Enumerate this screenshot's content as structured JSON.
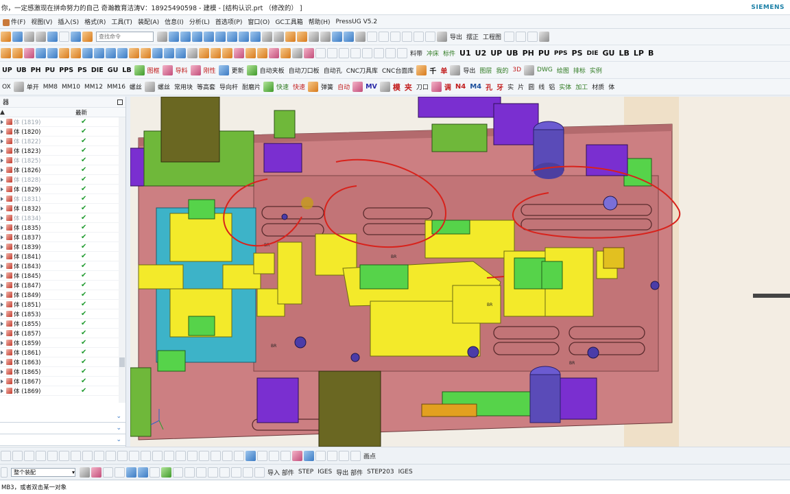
{
  "window": {
    "title": "你，一定感激现在拼命努力的自己  奇瀚教育洁涛V：18925490598 - 建模 - [结构认识.prt （修改的） ]",
    "brand": "SIEMENS"
  },
  "menubar": {
    "items": [
      {
        "label": "件(F)"
      },
      {
        "label": "视图(V)"
      },
      {
        "label": "插入(S)"
      },
      {
        "label": "格式(R)"
      },
      {
        "label": "工具(T)"
      },
      {
        "label": "装配(A)"
      },
      {
        "label": "信息(I)"
      },
      {
        "label": "分析(L)"
      },
      {
        "label": "首选项(P)"
      },
      {
        "label": "窗口(O)"
      },
      {
        "label": "GC工具箱"
      },
      {
        "label": "帮助(H)"
      },
      {
        "label": "PressUG V5.2"
      }
    ],
    "search_placeholder": "查找命令",
    "right_items": [
      "导出",
      "摆正",
      "工程图"
    ]
  },
  "toolbar2": {
    "labels": [
      "料带",
      "冲床",
      "标件",
      "U1",
      "U2",
      "UP",
      "UB",
      "PH",
      "PU",
      "PPS",
      "PS",
      "DIE",
      "GU",
      "LB",
      "LP",
      "B"
    ]
  },
  "toolbar3": {
    "left": [
      "UP",
      "UB",
      "PH",
      "PU",
      "PPS",
      "PS",
      "DIE",
      "GU",
      "LB"
    ],
    "mid": [
      "图框",
      "导料",
      "刚性",
      "更新",
      "自动夹板",
      "自动刀口板",
      "自动孔",
      "CNC刀具库",
      "CNC台面库"
    ],
    "right": [
      "千",
      "单",
      "导出",
      "图层",
      "我的",
      "3D",
      "DWG",
      "绘图",
      "排标",
      "实例"
    ]
  },
  "toolbar4": {
    "left": [
      "OX",
      "单开",
      "MM8",
      "MM10",
      "MM12",
      "MM16",
      "螺丝",
      "螺丝",
      "常用块",
      "等高套",
      "导向杆",
      "耐磨片"
    ],
    "mid": [
      "快速",
      "快速",
      "弹簧",
      "自动",
      "MV",
      "模",
      "夹",
      "刀口"
    ],
    "right": [
      "调",
      "N4",
      "M4",
      "孔",
      "牙",
      "实",
      "片",
      "圆",
      "线",
      "铝",
      "实体",
      "加工",
      "材质",
      "体"
    ]
  },
  "sidebar": {
    "header": "器",
    "col_name": "",
    "col_state": "最新",
    "rows": [
      {
        "label": "体 (1819)",
        "dim": true
      },
      {
        "label": "体 (1820)",
        "dim": false
      },
      {
        "label": "体 (1822)",
        "dim": true
      },
      {
        "label": "体 (1823)",
        "dim": false
      },
      {
        "label": "体 (1825)",
        "dim": true
      },
      {
        "label": "体 (1826)",
        "dim": false
      },
      {
        "label": "体 (1828)",
        "dim": true
      },
      {
        "label": "体 (1829)",
        "dim": false
      },
      {
        "label": "体 (1831)",
        "dim": true
      },
      {
        "label": "体 (1832)",
        "dim": false
      },
      {
        "label": "体 (1834)",
        "dim": true
      },
      {
        "label": "体 (1835)",
        "dim": false
      },
      {
        "label": "体 (1837)",
        "dim": false
      },
      {
        "label": "体 (1839)",
        "dim": false
      },
      {
        "label": "体 (1841)",
        "dim": false
      },
      {
        "label": "体 (1843)",
        "dim": false
      },
      {
        "label": "体 (1845)",
        "dim": false
      },
      {
        "label": "体 (1847)",
        "dim": false
      },
      {
        "label": "体 (1849)",
        "dim": false
      },
      {
        "label": "体 (1851)",
        "dim": false
      },
      {
        "label": "体 (1853)",
        "dim": false
      },
      {
        "label": "体 (1855)",
        "dim": false
      },
      {
        "label": "体 (1857)",
        "dim": false
      },
      {
        "label": "体 (1859)",
        "dim": false
      },
      {
        "label": "体 (1861)",
        "dim": false
      },
      {
        "label": "体 (1863)",
        "dim": false
      },
      {
        "label": "体 (1865)",
        "dim": false
      },
      {
        "label": "体 (1867)",
        "dim": false
      },
      {
        "label": "体 (1869)",
        "dim": false
      }
    ],
    "check_glyph": "✔"
  },
  "viewport": {
    "labels": [
      "BR",
      "BR",
      "BR",
      "BR",
      "BR"
    ]
  },
  "bottombar": {
    "select_value": "整个装配",
    "right_items": [
      "导入 部件",
      "STEP",
      "IGES",
      "导出 部件",
      "STEP203",
      "IGES"
    ],
    "mid_items": [
      "画点"
    ]
  },
  "status": {
    "text": "MB3，或者双击某一对象"
  }
}
